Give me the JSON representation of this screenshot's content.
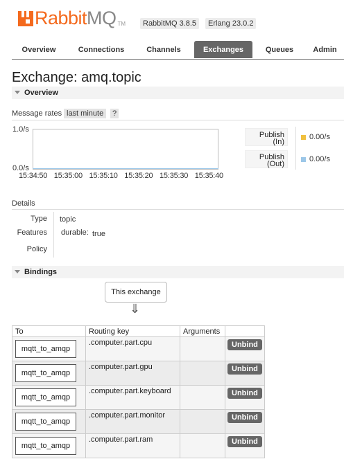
{
  "header": {
    "logo_rabbit": "Rabbit",
    "logo_mq": "MQ",
    "logo_tm": "TM",
    "version": "RabbitMQ 3.8.5",
    "erlang": "Erlang 23.0.2"
  },
  "tabs": [
    "Overview",
    "Connections",
    "Channels",
    "Exchanges",
    "Queues",
    "Admin"
  ],
  "active_tab": "Exchanges",
  "title": "Exchange: amq.topic",
  "overview": {
    "section_label": "Overview",
    "message_rates_label": "Message rates",
    "rate_period": "last minute",
    "help": "?",
    "y_top": "1.0/s",
    "y_bottom": "0.0/s",
    "x_ticks": [
      "15:34:50",
      "15:35:00",
      "15:35:10",
      "15:35:20",
      "15:35:30",
      "15:35:40"
    ],
    "legend": [
      {
        "label1": "Publish",
        "label2": "(In)",
        "value": "0.00/s",
        "color": "#f0c040"
      },
      {
        "label1": "Publish",
        "label2": "(Out)",
        "value": "0.00/s",
        "color": "#9cc7e8"
      }
    ]
  },
  "details": {
    "section_label": "Details",
    "type_label": "Type",
    "type_value": "topic",
    "features_label": "Features",
    "durable_label": "durable:",
    "durable_value": "true",
    "policy_label": "Policy"
  },
  "bindings": {
    "section_label": "Bindings",
    "this_exchange": "This exchange",
    "arrow": "⇓",
    "columns": [
      "To",
      "Routing key",
      "Arguments",
      ""
    ],
    "unbind_label": "Unbind",
    "rows": [
      {
        "to": "mqtt_to_amqp",
        "routing_key": ".computer.part.cpu",
        "arguments": ""
      },
      {
        "to": "mqtt_to_amqp",
        "routing_key": ".computer.part.gpu",
        "arguments": ""
      },
      {
        "to": "mqtt_to_amqp",
        "routing_key": ".computer.part.keyboard",
        "arguments": ""
      },
      {
        "to": "mqtt_to_amqp",
        "routing_key": ".computer.part.monitor",
        "arguments": ""
      },
      {
        "to": "mqtt_to_amqp",
        "routing_key": ".computer.part.ram",
        "arguments": ""
      }
    ]
  }
}
